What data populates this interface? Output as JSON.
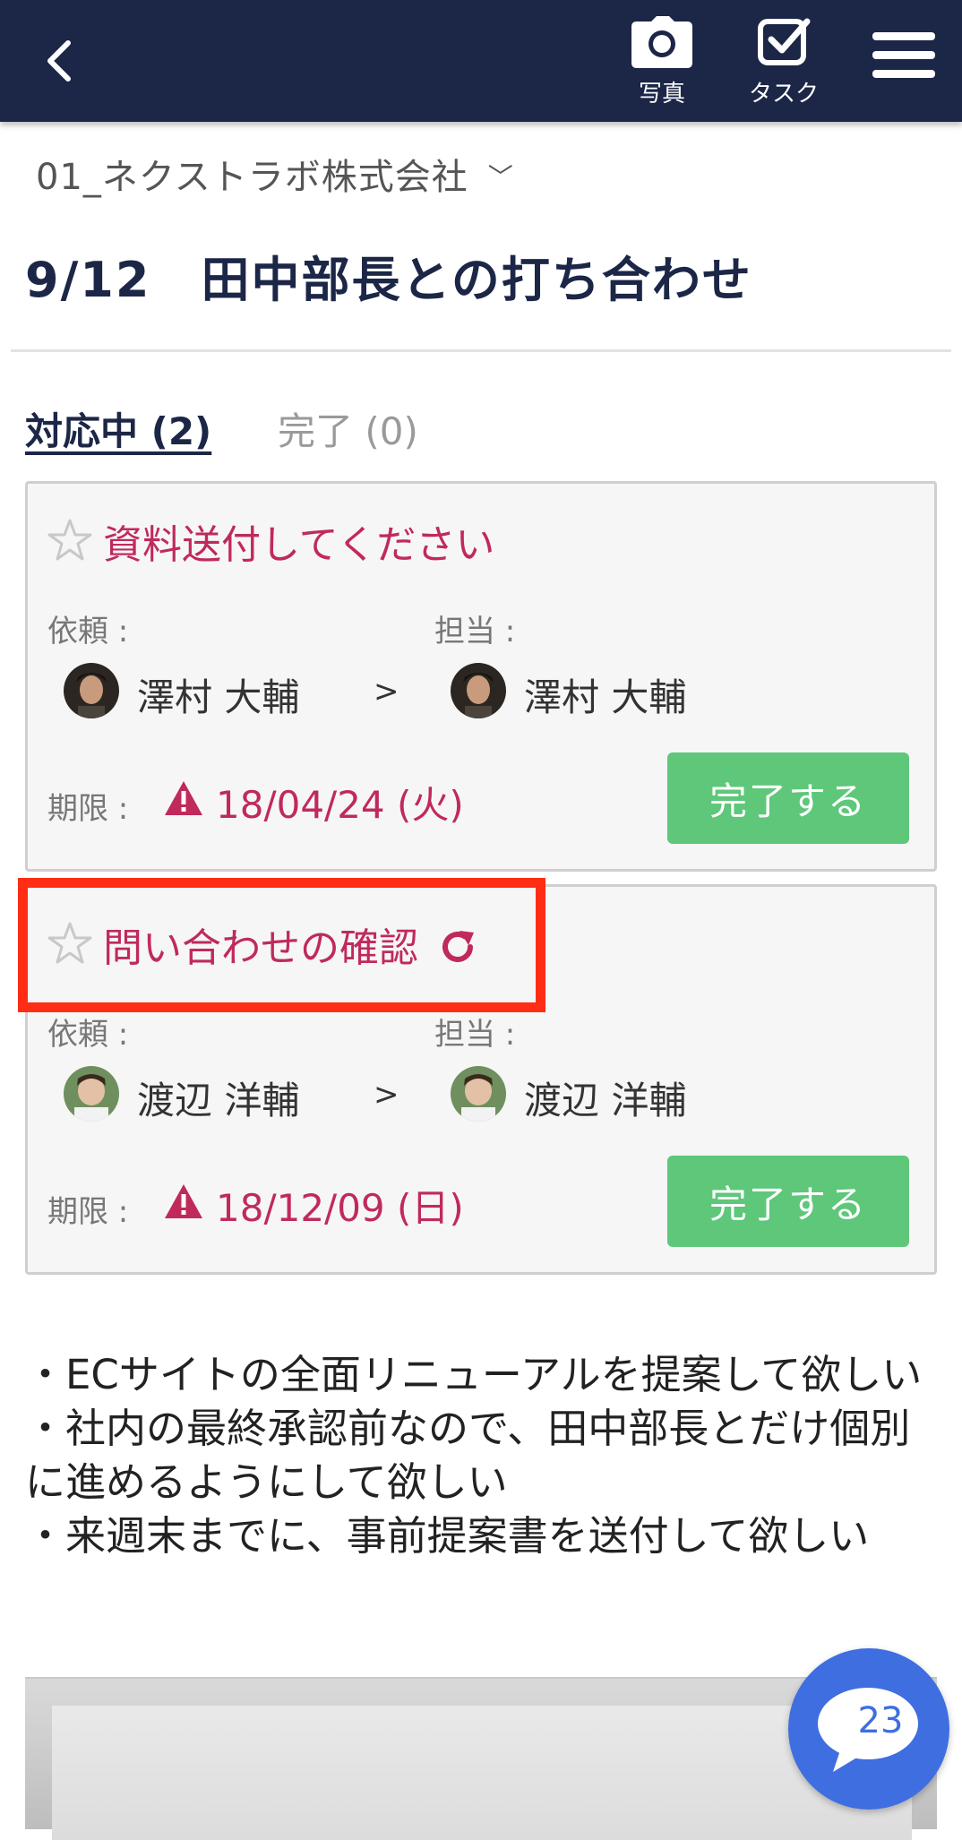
{
  "header": {
    "photo_label": "写真",
    "task_label": "タスク",
    "bg_color": "#1c2647"
  },
  "company": {
    "name": "01_ネクストラボ株式会社"
  },
  "meeting": {
    "title": "9/12　田中部長との打ち合わせ"
  },
  "tabs": [
    {
      "label": "対応中 (2)",
      "active": true
    },
    {
      "label": "完了 (0)",
      "active": false
    }
  ],
  "tasks": [
    {
      "title": "資料送付してください",
      "requester_label": "依頼 :",
      "assignee_label": "担当 :",
      "requester": "澤村 大輔",
      "arrow": ">",
      "assignee": "澤村 大輔",
      "due_label": "期限 :",
      "due_date": "18/04/24 (火)",
      "complete_label": "完了する",
      "repeat": false
    },
    {
      "title": "問い合わせの確認",
      "requester_label": "依頼 :",
      "assignee_label": "担当 :",
      "requester": "渡辺 洋輔",
      "arrow": ">",
      "assignee": "渡辺 洋輔",
      "due_label": "期限 :",
      "due_date": "18/12/09 (日)",
      "complete_label": "完了する",
      "repeat": true
    }
  ],
  "notes": [
    "・ECサイトの全面リニューアルを提案して欲しい",
    "・社内の最終承認前なので、田中部長とだけ個別に進めるようにして欲しい",
    "・来週末までに、事前提案書を送付して欲しい"
  ],
  "chat": {
    "count": "23"
  },
  "colors": {
    "accent_red": "#c02a5b",
    "complete_green": "#5ec77a",
    "chat_blue": "#3e6ee0",
    "highlight_red": "#ff2d14"
  }
}
